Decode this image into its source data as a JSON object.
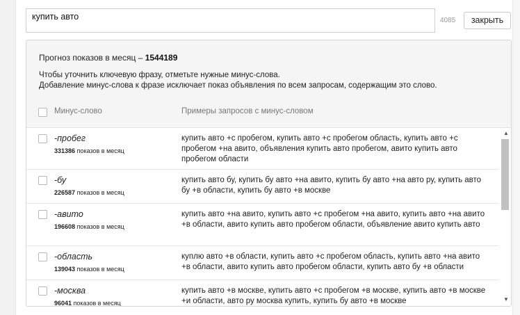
{
  "search": {
    "value": "купить авто",
    "char_count": "4085"
  },
  "close_label": "закрыть",
  "forecast": {
    "label": "Прогноз показов в месяц –",
    "value": "1544189"
  },
  "hint": {
    "line1": "Чтобы уточнить ключевую фразу, отметьте нужные минус-слова.",
    "line2": "Добавление минус-слова к фразе исключает показ объявления по всем запросам, содержащим это слово."
  },
  "columns": {
    "word": "Минус-слово",
    "examples": "Примеры запросов с минус-словом"
  },
  "rows": [
    {
      "word": "-пробег",
      "count": "331386",
      "unit": "показов в месяц",
      "examples": "купить авто +с пробегом, купить авто +с пробегом область, купить авто +с пробегом +на авито, объявления купить авто пробегом, авито купить авто пробегом области"
    },
    {
      "word": "-бу",
      "count": "226587",
      "unit": "показов в месяц",
      "examples": "купить авто бу, купить бу авто +на авито, купить бу авто +на авто ру, купить авто бу +в области, купить бу авто +в москве"
    },
    {
      "word": "-авито",
      "count": "196608",
      "unit": "показов в месяц",
      "examples": "купить авто +на авито, купить авто +с пробегом +на авито, купить авто +на авито +в области, авито купить авто пробегом области, объявление авито купить авто"
    },
    {
      "word": "-область",
      "count": "139043",
      "unit": "показов в месяц",
      "examples": "куплю авто +в области, купить авто +с пробегом область, купить авто +на авито +в области, авито купить авто пробегом области, купить авто бу +в области"
    },
    {
      "word": "-москва",
      "count": "96041",
      "unit": "показов в месяц",
      "examples": "купить авто +в москве, купить авто +с пробегом +в москве, купить авто +в москве +и области, авто ру москва купить, купить бу авто +в москве"
    }
  ],
  "icons": {
    "scroll_up": "triangle-up",
    "scroll_down": "triangle-down",
    "checkbox": "square-outline"
  }
}
